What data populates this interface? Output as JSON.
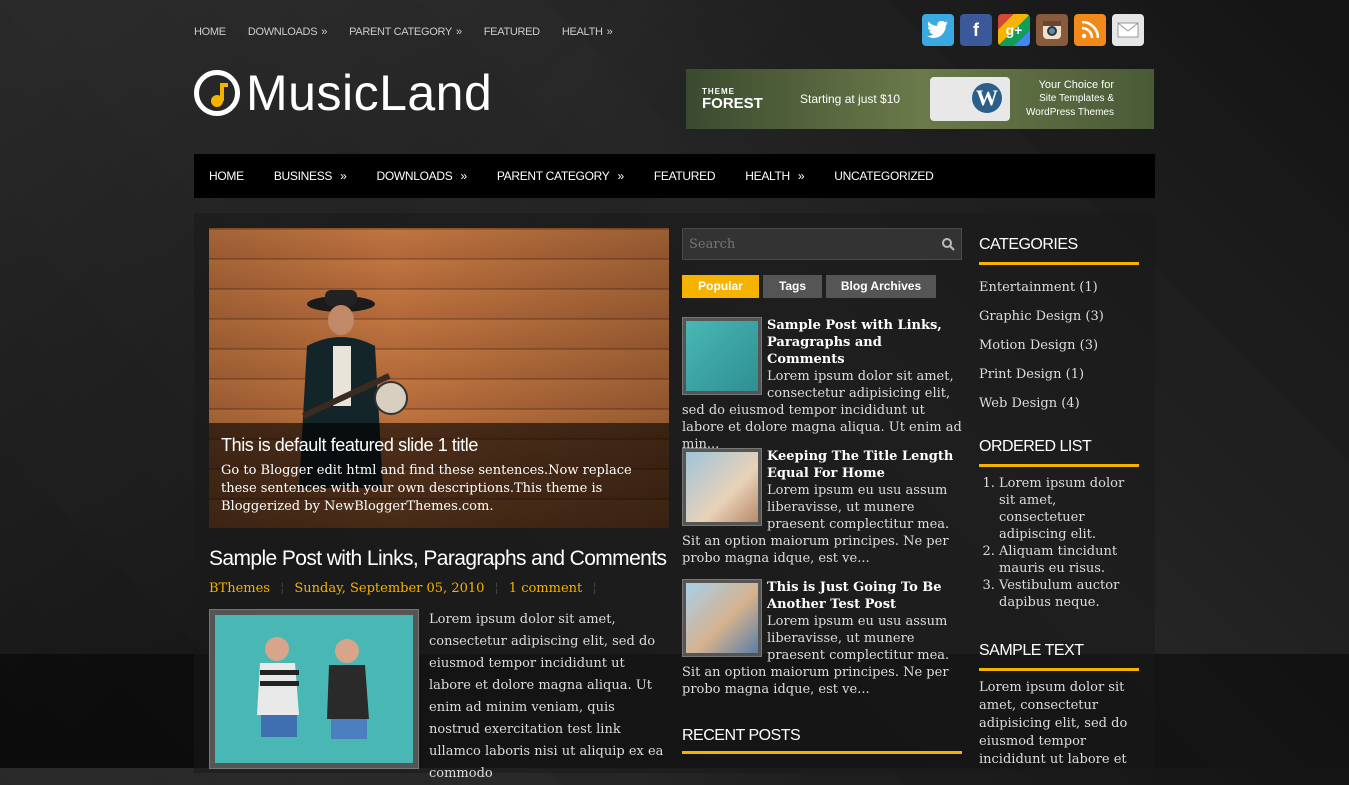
{
  "top_nav": [
    {
      "label": "HOME",
      "arrow": ""
    },
    {
      "label": "DOWNLOADS",
      "arrow": "»"
    },
    {
      "label": "PARENT CATEGORY",
      "arrow": "»"
    },
    {
      "label": "FEATURED",
      "arrow": ""
    },
    {
      "label": "HEALTH",
      "arrow": "»"
    }
  ],
  "social_icons": [
    "twitter-icon",
    "facebook-icon",
    "google-plus-icon",
    "instagram-icon",
    "rss-icon",
    "email-icon"
  ],
  "logo": {
    "name": "MusicLand"
  },
  "banner": {
    "brand_small": "THEME",
    "brand": "FOREST",
    "tagline": "Starting at just $10",
    "right_line1": "Your Choice for",
    "right_line2": "Site Templates &",
    "right_line3": "WordPress Themes"
  },
  "main_nav": [
    {
      "label": "HOME",
      "arrow": ""
    },
    {
      "label": "BUSINESS",
      "arrow": "»"
    },
    {
      "label": "DOWNLOADS",
      "arrow": "»"
    },
    {
      "label": "PARENT CATEGORY",
      "arrow": "»"
    },
    {
      "label": "FEATURED",
      "arrow": ""
    },
    {
      "label": "HEALTH",
      "arrow": "»"
    },
    {
      "label": "UNCATEGORIZED",
      "arrow": ""
    }
  ],
  "slider": {
    "title": "This is default featured slide 1 title",
    "description": "Go to Blogger edit html and find these sentences.Now replace these sentences with your own descriptions.This theme is Bloggerized by NewBloggerThemes.com."
  },
  "post": {
    "title": "Sample Post with Links, Paragraphs and Comments",
    "author": "BThemes",
    "date": "Sunday, September 05, 2010",
    "comments": "1 comment",
    "body": "Lorem ipsum dolor sit amet, consectetur adipiscing elit, sed do eiusmod tempor incididunt ut labore et dolore magna aliqua. Ut enim ad minim veniam, quis nostrud exercitation test link ullamco laboris nisi ut aliquip ex ea commodo"
  },
  "search": {
    "placeholder": "Search"
  },
  "tabs": [
    "Popular",
    "Tags",
    "Blog Archives"
  ],
  "popular": [
    {
      "title": "Sample Post with Links, Paragraphs and Comments",
      "excerpt": "Lorem ipsum dolor sit amet, consectetur adipisicing elit, sed do eiusmod tempor incididunt ut labore et dolore magna aliqua. Ut enim ad min..."
    },
    {
      "title": "Keeping The Title Length Equal For Home",
      "excerpt": "Lorem ipsum eu usu assum liberavisse, ut munere praesent complectitur mea. Sit an option maiorum principes. Ne per probo magna idque, est ve..."
    },
    {
      "title": "This is Just Going To Be Another Test Post",
      "excerpt": "Lorem ipsum eu usu assum liberavisse, ut munere praesent complectitur mea. Sit an option maiorum principes. Ne per probo magna idque, est ve..."
    }
  ],
  "recent_posts_heading": "RECENT POSTS",
  "categories_heading": "CATEGORIES",
  "categories": [
    "Entertainment (1)",
    "Graphic Design (3)",
    "Motion Design (3)",
    "Print Design (1)",
    "Web Design (4)"
  ],
  "ordered_list_heading": "ORDERED LIST",
  "ordered_list": [
    "Lorem ipsum dolor sit amet, consectetuer adipiscing elit.",
    "Aliquam tincidunt mauris eu risus.",
    "Vestibulum auctor dapibus neque."
  ],
  "sample_text_heading": "SAMPLE TEXT",
  "sample_text": "Lorem ipsum dolor sit amet, consectetur adipisicing elit, sed do eiusmod tempor incididunt ut labore et",
  "colors": {
    "accent": "#f5b300",
    "nav_bg": "#000000"
  }
}
